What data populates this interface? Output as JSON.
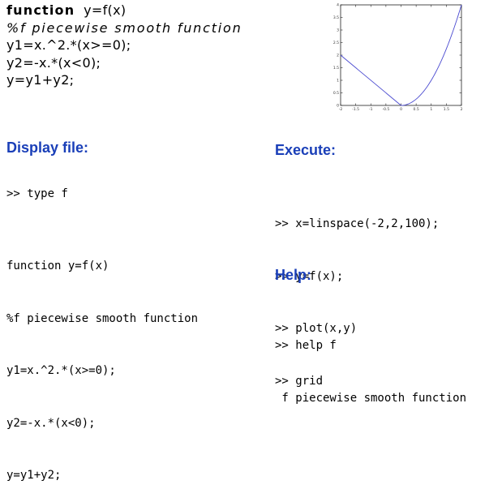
{
  "top_code": {
    "lines": [
      "function y=f(x)",
      "%f piecewise smooth function",
      "y1=x.^2.*(x>=0);",
      "y2=-x.*(x<0);",
      "y=y1+y2;"
    ]
  },
  "chart_data": {
    "type": "line",
    "x": [
      -2,
      -1.5,
      -1,
      -0.5,
      0,
      0.5,
      1,
      1.5,
      2
    ],
    "series": [
      {
        "values": [
          2,
          1.5,
          1,
          0.5,
          0,
          0.25,
          1,
          2.25,
          4
        ],
        "color": "#4a4ad0"
      }
    ],
    "xticks": [
      "-2",
      "-1.5",
      "-1",
      "-0.5",
      "0",
      "0.5",
      "1",
      "1.5",
      "2"
    ],
    "yticks": [
      "0",
      "0.5",
      "1",
      "1.5",
      "2",
      "2.5",
      "3",
      "3.5",
      "4"
    ],
    "xlim": [
      -2,
      2
    ],
    "ylim": [
      0,
      4
    ],
    "grid": false
  },
  "display": {
    "heading": "Display file:",
    "command": ">> type f",
    "listing": [
      "function y=f(x)",
      "%f piecewise smooth function",
      "y1=x.^2.*(x>=0);",
      "y2=-x.*(x<0);",
      "y=y1+y2;"
    ]
  },
  "execute": {
    "heading": "Execute:",
    "lines": [
      ">> x=linspace(-2,2,100);",
      ">> y=f(x);",
      ">> plot(x,y)",
      ">> grid"
    ]
  },
  "help": {
    "heading": "Help:",
    "lines": [
      ">> help f",
      " f piecewise smooth function"
    ]
  },
  "colors": {
    "heading": "#1a3fb8",
    "plot_line": "#4a4ad0"
  }
}
